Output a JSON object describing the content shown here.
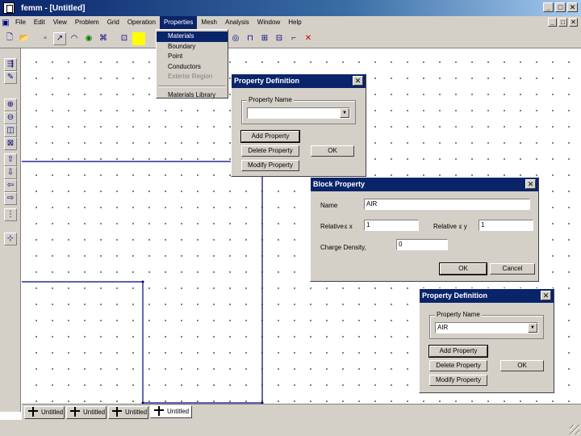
{
  "window": {
    "title": "femm - [Untitled]"
  },
  "menubar": {
    "items": [
      "File",
      "Edit",
      "View",
      "Problem",
      "Grid",
      "Operation",
      "Properties",
      "Mesh",
      "Analysis",
      "Window",
      "Help"
    ],
    "active": "Properties"
  },
  "properties_menu": {
    "items": [
      "Materials",
      "Boundary",
      "Point",
      "Conductors",
      "Exterior Region"
    ],
    "after_separator": [
      "Materials Library"
    ]
  },
  "tabs": [
    "Untitled",
    "Untitled",
    "Untitled",
    "Untitled"
  ],
  "dialog1": {
    "title": "Property Definition",
    "group_label": "Property Name",
    "combo_value": "",
    "add": "Add Property",
    "delete": "Delete Property",
    "modify": "Modify Property",
    "ok": "OK"
  },
  "block_property": {
    "title": "Block Property",
    "name_label": "Name",
    "name_value": "AIR",
    "relative_x_label": "Relative",
    "epsilon_x": "ε x",
    "relative_x_value": "1",
    "relative_y_label": "Relative",
    "epsilon_y": "ε y",
    "relative_y_value": "1",
    "charge_label": "Charge Density,",
    "charge_value": "0",
    "ok": "OK",
    "cancel": "Cancel"
  },
  "dialog2": {
    "title": "Property Definition",
    "group_label": "Property Name",
    "combo_value": "AIR",
    "add": "Add Property",
    "delete": "Delete Property",
    "modify": "Modify Property",
    "ok": "OK"
  },
  "icons": {
    "title_minimize": "_",
    "title_maximize": "□",
    "title_close": "✕",
    "dialog_close": "✕",
    "combo_arrow": "▼"
  },
  "colors": {
    "titlebar": "#0a246a",
    "highlight": "#0a246a",
    "face": "#d4d0c8",
    "geometry": "#000080"
  }
}
